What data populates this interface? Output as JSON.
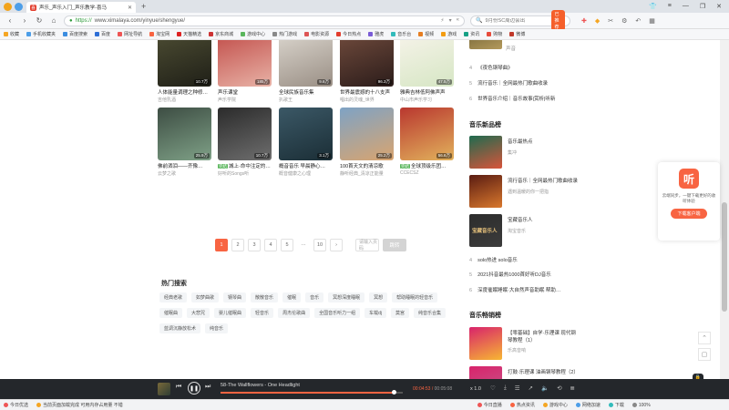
{
  "browser": {
    "tab_title": "声乐_声乐入门_声乐教学-喜马",
    "url_prefix": "https://",
    "url": "www.ximalaya.com/yinyue/shengyue/",
    "search_placeholder": "9月份SC周边会出",
    "search_badge": "已推荐"
  },
  "bookmarks": [
    "收藏",
    "手机收藏夹",
    "百度搜索",
    "百度",
    "网址导航",
    "淘宝网",
    "天猫精选",
    "京东商城",
    "游戏中心",
    "热门游戏",
    "电影资源",
    "今日热点",
    "雅虎",
    "音乐台",
    "视频",
    "游戏",
    "资讯",
    "购物",
    "微博"
  ],
  "albums_row1": [
    {
      "title": "人体能量调理之种修…",
      "sub": "吉他乳酒",
      "count": "10.7万",
      "bg": "linear-gradient(160deg,#4b4b32,#1f1f17)"
    },
    {
      "title": "声乐课堂",
      "sub": "声乐学院",
      "count": "185万",
      "bg": "linear-gradient(160deg,#c24f4b,#e8b2a6)"
    },
    {
      "title": "全球民族音乐集",
      "sub": "扒歌王",
      "count": "9.6万",
      "bg": "linear-gradient(160deg,#d9d4cc,#9a8f85)"
    },
    {
      "title": "世界最震撼的十八支声",
      "sub": "唱出的灵魂_世界",
      "count": "96.3万",
      "bg": "linear-gradient(160deg,#6f4a3c,#2b1c1a)"
    },
    {
      "title": "雅典吉林低阿佛声声",
      "sub": "中山市声乐学习",
      "count": "47.5万",
      "bg": "linear-gradient(160deg,#f6f3e9,#d6e6c4)"
    }
  ],
  "albums_row2": [
    {
      "title": "佛前洒泪——齐豫…",
      "sub": "云梦之歌",
      "count": "25.9万",
      "tag": "",
      "bg": "linear-gradient(160deg,#3d4d43,#7fa187)"
    },
    {
      "title": "城上·命中注定的…",
      "sub": "好听的Songs听",
      "count": "10.7万",
      "tag": "完结",
      "bg": "linear-gradient(160deg,#2b2b2b,#6e6e6e)"
    },
    {
      "title": "概音音乐 早晨静心…",
      "sub": "概音健康之心理",
      "count": "3.1万",
      "tag": "",
      "bg": "linear-gradient(160deg,#3b5866,#1b2e36)"
    },
    {
      "title": "100首天文的清凉歌",
      "sub": "静听经典_清凉正能量",
      "count": "25.2万",
      "tag": "",
      "bg": "linear-gradient(160deg,#7ea3c5,#d9a46f)"
    },
    {
      "title": "全球顶级乐团…",
      "sub": "CCECSZ",
      "count": "56.6万",
      "tag": "完结",
      "bg": "linear-gradient(160deg,#b9372f,#e2b25c)"
    }
  ],
  "pager": {
    "pages": [
      "1",
      "2",
      "3",
      "4",
      "5",
      "···",
      "10"
    ],
    "prev": "‹",
    "next": "›",
    "input_placeholder": "请输入页码",
    "go": "跳转"
  },
  "hot": {
    "title": "热门搜索",
    "tags": [
      "经典老歌",
      "如梦曲歌",
      "钢琴曲",
      "散散音乐",
      "催眠",
      "音乐",
      "冥想深度睡眠",
      "冥想",
      "帮助睡眠的轻音乐",
      "催眠曲",
      "大悲咒",
      "婴儿催眠曲",
      "轻音乐",
      "周杰伦歌曲",
      "全国音乐听力一组",
      "车载dj",
      "莫宫",
      "纯音乐合集",
      "蓝调沉静放松术",
      "纯音乐"
    ]
  },
  "right": {
    "top_list": [
      {
        "num": "4",
        "text": "《夜色钢琴曲》"
      },
      {
        "num": "5",
        "text": "流行音乐｜全网最热门歌曲收录"
      },
      {
        "num": "6",
        "text": "世界音乐介绍｜音乐故事|赏析|听新"
      }
    ],
    "top_author": "声音",
    "new_title": "音乐新品榜",
    "new_charts": [
      {
        "name": "音乐最热点",
        "author": "集冲",
        "bg": "linear-gradient(160deg,#1e6b4f,#d8543a)"
      },
      {
        "name": "流行音乐｜全网最热门歌曲收录",
        "author": "遇到温暖的你一把指",
        "bg": "linear-gradient(160deg,#5a1c12,#d9782d)"
      },
      {
        "name": "宝藏音乐人",
        "author": "淘宝音乐",
        "bg": "linear-gradient(160deg,#2c2c2c,#3c3c3c)"
      }
    ],
    "new_list": [
      {
        "num": "4",
        "text": "solo热进 solo音乐"
      },
      {
        "num": "5",
        "text": "2021抖音最热1000首好听DJ音乐"
      },
      {
        "num": "6",
        "text": "深度催眠睡眠·大自然声音助眠 帮助…"
      }
    ],
    "best_title": "音乐畅销榜",
    "best_charts": [
      {
        "name": "【零基础】自学·乐理课 现代钢琴教程（1）",
        "author": "乐高音响",
        "bg": "linear-gradient(160deg,#d8236b,#f7b733)"
      },
      {
        "name": "打鼓·乐理课 油画钢琴教程（2）",
        "author": "乐高音响",
        "bg": "linear-gradient(160deg,#d8236b,#c55a8a)"
      }
    ]
  },
  "promo": {
    "logo": "听",
    "text": "云端同步，一键下载更好的收听体验",
    "button": "下载客户端"
  },
  "player": {
    "track": "58-The Wallflowers - One Headlight",
    "elapsed": "00:04:53",
    "total": "00:05:08",
    "speed": "x 1.0",
    "progress": 0.95
  },
  "status": [
    "今日优选",
    "当前页面加载完成 可用内存占用量 不错",
    "今日直播",
    "热点资讯",
    "游戏中心",
    "网络加速",
    "下载",
    "100%"
  ]
}
